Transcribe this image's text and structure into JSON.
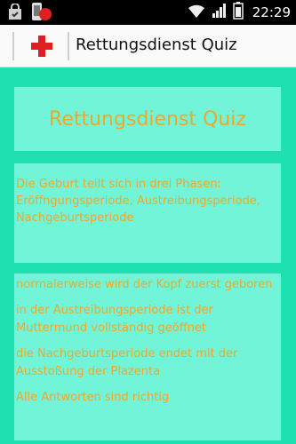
{
  "status_bar": {
    "time": "22:29",
    "icons": [
      "shopping-bag-icon",
      "phone-record-icon",
      "wifi-icon",
      "signal-icon",
      "battery-icon"
    ]
  },
  "action_bar": {
    "app_icon": "red-cross-icon",
    "title": "Rettungsdienst Quiz"
  },
  "quiz": {
    "heading": "Rettungsdienst Quiz",
    "question": "Die Geburt teilt sich in drei Phasen: Eröffngungsperiode, Austreibungsperiode, Nachgeburtsperiode",
    "answers": [
      "normalerweise wird der Kopf zuerst geboren",
      "in der Austreibungsperiode ist der Muttermund vollständig geöffnet",
      "die Nachgeburtsperiode endet mit der Ausstoßung der Plazenta",
      "Alle Antworten sind richtig"
    ]
  },
  "colors": {
    "background": "#1fe0b0",
    "panel": "#72f4d8",
    "text": "#f0a828",
    "cross": "#e02020"
  }
}
